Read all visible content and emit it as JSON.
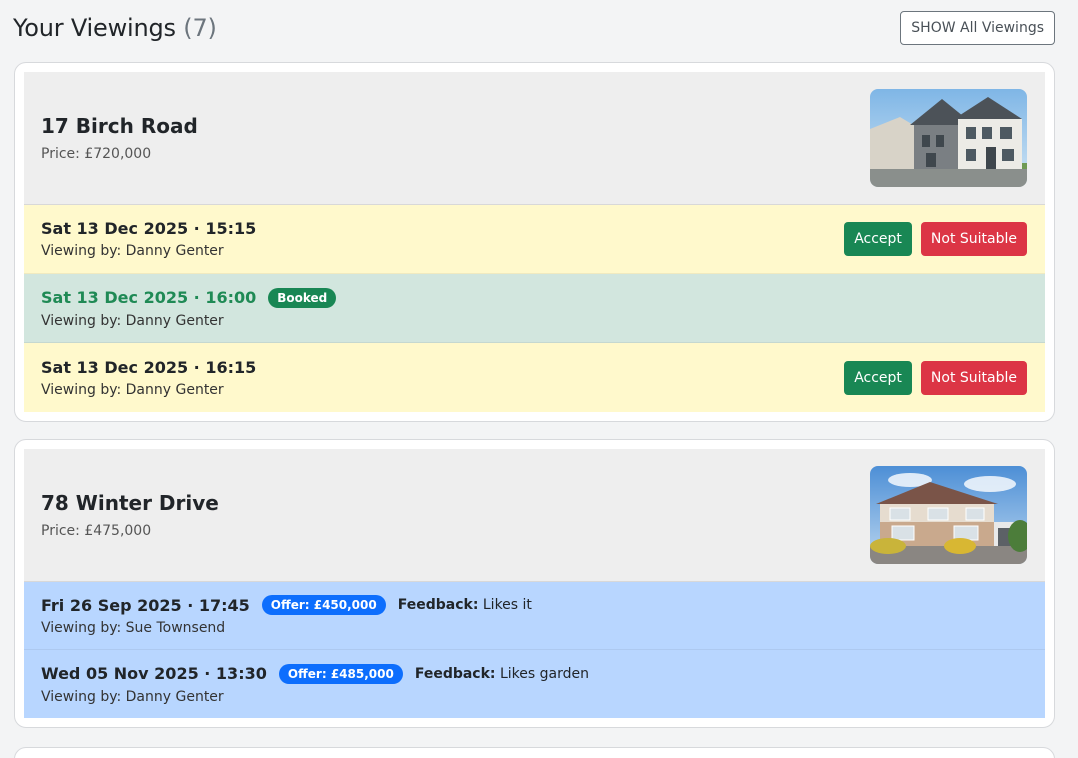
{
  "header": {
    "title": "Your Viewings",
    "count": "(7)",
    "show_all_label": "SHOW All Viewings"
  },
  "properties": [
    {
      "name": "17 Birch Road",
      "price": "Price: £720,000",
      "image_icon": "house-photo",
      "viewings": [
        {
          "when": "Sat 13 Dec 2025 · 15:15",
          "by": "Viewing by: Danny Genter",
          "status": "pending",
          "accept_label": "Accept",
          "reject_label": "Not Suitable"
        },
        {
          "when": "Sat 13 Dec 2025 · 16:00",
          "by": "Viewing by: Danny Genter",
          "status": "booked",
          "badge": "Booked"
        },
        {
          "when": "Sat 13 Dec 2025 · 16:15",
          "by": "Viewing by: Danny Genter",
          "status": "pending",
          "accept_label": "Accept",
          "reject_label": "Not Suitable"
        }
      ]
    },
    {
      "name": "78 Winter Drive",
      "price": "Price: £475,000",
      "image_icon": "house-photo",
      "viewings": [
        {
          "when": "Fri 26 Sep 2025 · 17:45",
          "by": "Viewing by: Sue Townsend",
          "status": "offer",
          "badge": "Offer: £450,000",
          "feedback_label": "Feedback:",
          "feedback": "Likes it"
        },
        {
          "when": "Wed 05 Nov 2025 · 13:30",
          "by": "Viewing by: Danny Genter",
          "status": "offer",
          "badge": "Offer: £485,000",
          "feedback_label": "Feedback:",
          "feedback": "Likes garden"
        }
      ]
    }
  ],
  "colors": {
    "pending_row": "#fff9cc",
    "booked_row": "#d2e6de",
    "offer_row": "#b8d6ff",
    "accept": "#198754",
    "not_suitable": "#dc3545",
    "offer_badge": "#0d6efd"
  }
}
